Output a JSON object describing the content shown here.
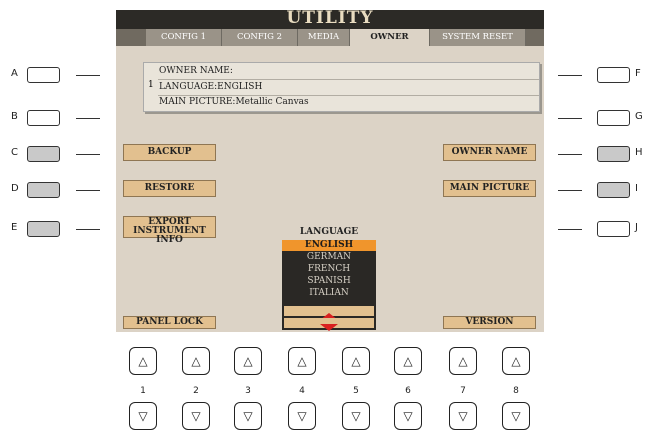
{
  "screen": {
    "title": "UTILITY",
    "tabs": [
      "CONFIG 1",
      "CONFIG 2",
      "MEDIA",
      "OWNER",
      "SYSTEM RESET"
    ],
    "active_tab": "OWNER"
  },
  "info": {
    "number": "1",
    "rows": [
      "OWNER NAME:",
      "LANGUAGE:ENGLISH",
      "MAIN PICTURE:Metallic Canvas"
    ]
  },
  "buttons": {
    "backup": "BACKUP",
    "restore": "RESTORE",
    "export_line1": "EXPORT",
    "export_line2": "INSTRUMENT INFO",
    "owner_name": "OWNER NAME",
    "main_picture": "MAIN PICTURE",
    "panel_lock": "PANEL LOCK",
    "version": "VERSION"
  },
  "language": {
    "label": "LANGUAGE",
    "options": [
      "ENGLISH",
      "GERMAN",
      "FRENCH",
      "SPANISH",
      "ITALIAN"
    ],
    "selected": "ENGLISH"
  },
  "side_buttons": {
    "left": [
      "A",
      "B",
      "C",
      "D",
      "E"
    ],
    "right": [
      "F",
      "G",
      "H",
      "I",
      "J"
    ]
  },
  "bottom_buttons": {
    "numbers": [
      "1",
      "2",
      "3",
      "4",
      "5",
      "6",
      "7",
      "8"
    ],
    "up_glyph": "△",
    "down_glyph": "▽"
  },
  "colors": {
    "screen_bg": "#dcd3c6",
    "title_bar": "#2c2a26",
    "button_fill": "#e2c08f",
    "selection": "#f0952c"
  }
}
